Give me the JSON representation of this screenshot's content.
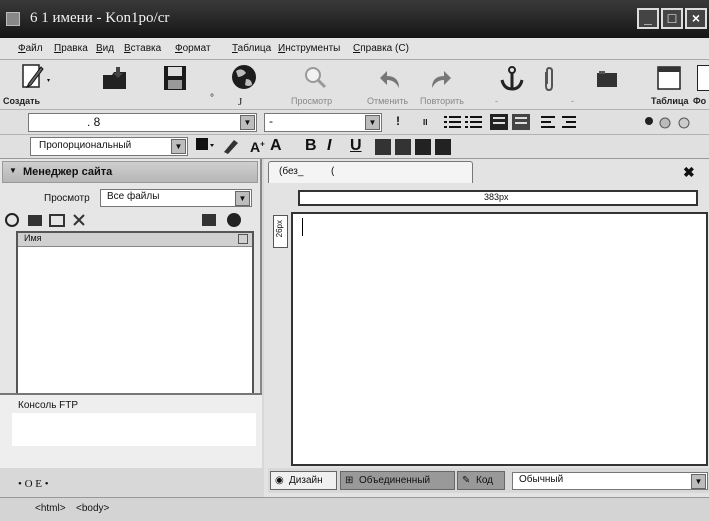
{
  "window": {
    "title": "6 1 имени - Kon1po/cr",
    "buttons": [
      "minimize",
      "maximize",
      "close"
    ]
  },
  "menu": [
    "Файл",
    "Правка",
    "Вид",
    "Вставка",
    "Формат",
    "Таблица",
    "Инструменты",
    "Справка (С)"
  ],
  "toolbar": {
    "create": "Создать",
    "preview": "Просмотр",
    "undo": "Отменить",
    "redo": "Повторить",
    "table": "Таблица",
    "truncated": "Фо",
    "stray_o": "°",
    "stray_j": "J"
  },
  "format_row1": {
    "paragraph_value": ". 8",
    "font_value": "-",
    "exclaim": "!",
    "ii": "II"
  },
  "format_row2": {
    "font_family": "Пропорциональный",
    "bold": "B",
    "italic": "I",
    "underline": "U"
  },
  "site_manager": {
    "title": "Менеджер сайта",
    "view_label": "Просмотр",
    "filter_value": "Все файлы",
    "col_name": "Имя"
  },
  "ftp": {
    "title": "Консоль FTP",
    "footer": "• О  E  •"
  },
  "editor": {
    "tab_label": "(без_",
    "tab_close": "(",
    "width_label": "383px",
    "vruler_label": "26px"
  },
  "modes": {
    "design": "Дизайн",
    "split": "Объединенный",
    "code": "Код",
    "style": "Обычный"
  },
  "statusbar": {
    "tag1": "<html>",
    "tag2": "<body>"
  }
}
